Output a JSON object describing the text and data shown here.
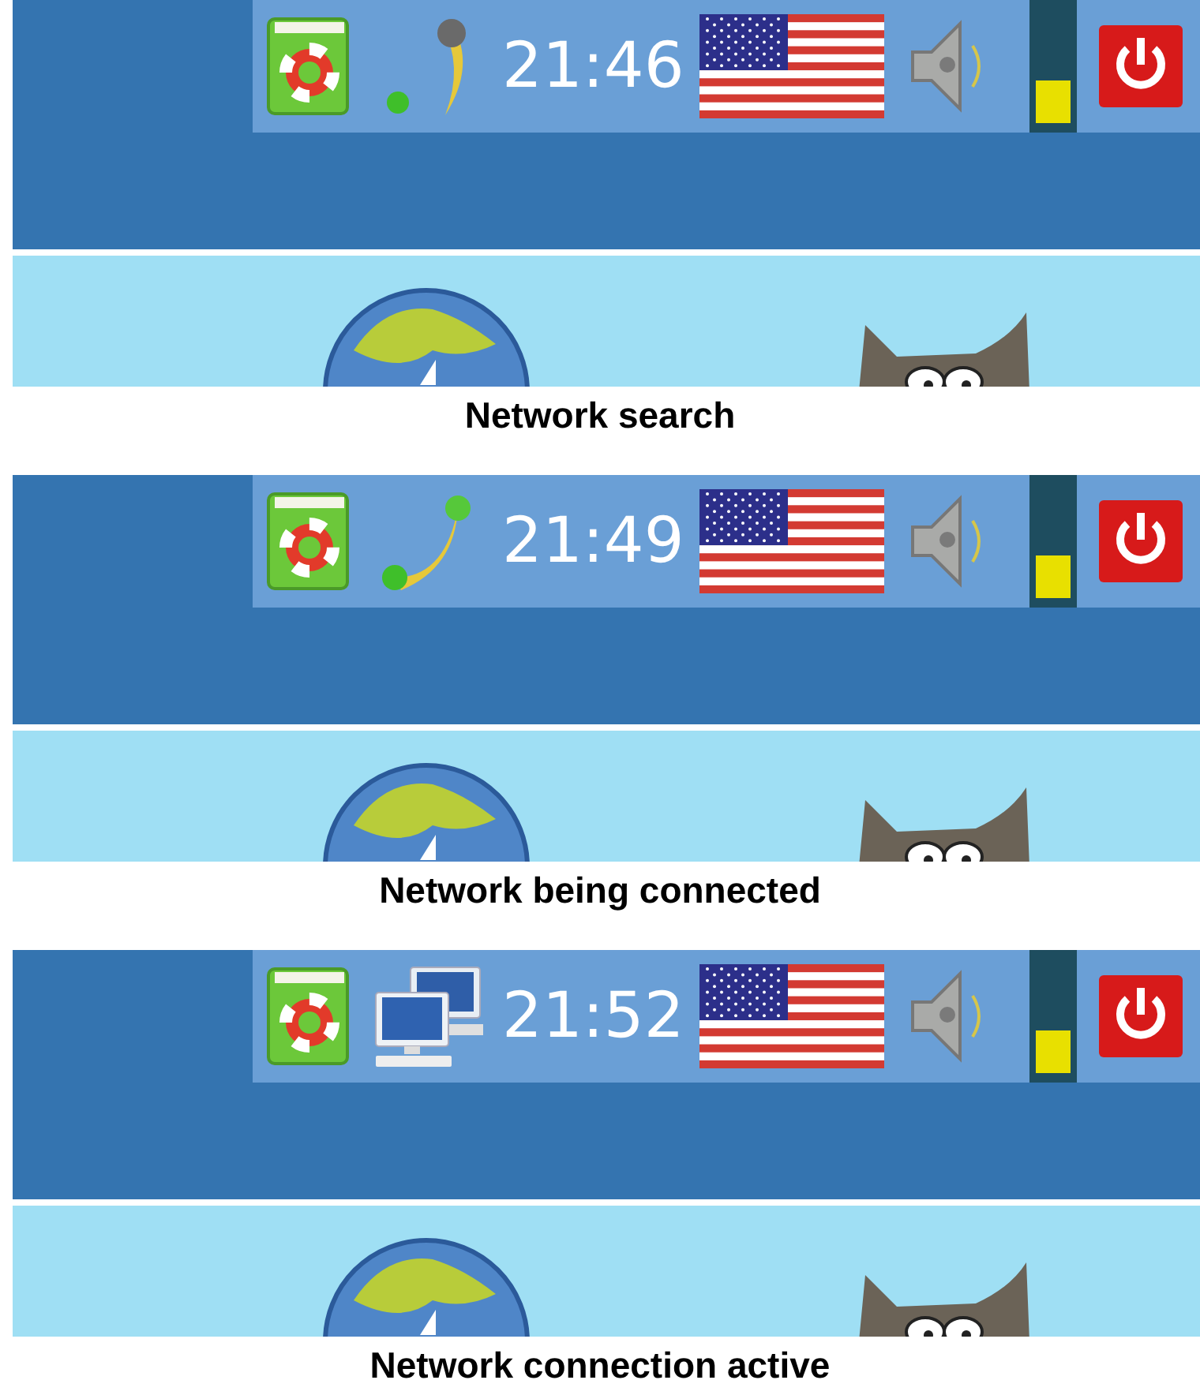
{
  "panels": [
    {
      "network": {
        "kind": "searching"
      },
      "clock": "21:46",
      "meter": {
        "level": 0.35
      },
      "caption": "Network search"
    },
    {
      "network": {
        "kind": "connecting"
      },
      "clock": "21:49",
      "meter": {
        "level": 0.35
      },
      "caption": "Network being connected"
    },
    {
      "network": {
        "kind": "connected"
      },
      "clock": "21:52",
      "meter": {
        "level": 0.35
      },
      "caption": "Network connection active"
    }
  ]
}
